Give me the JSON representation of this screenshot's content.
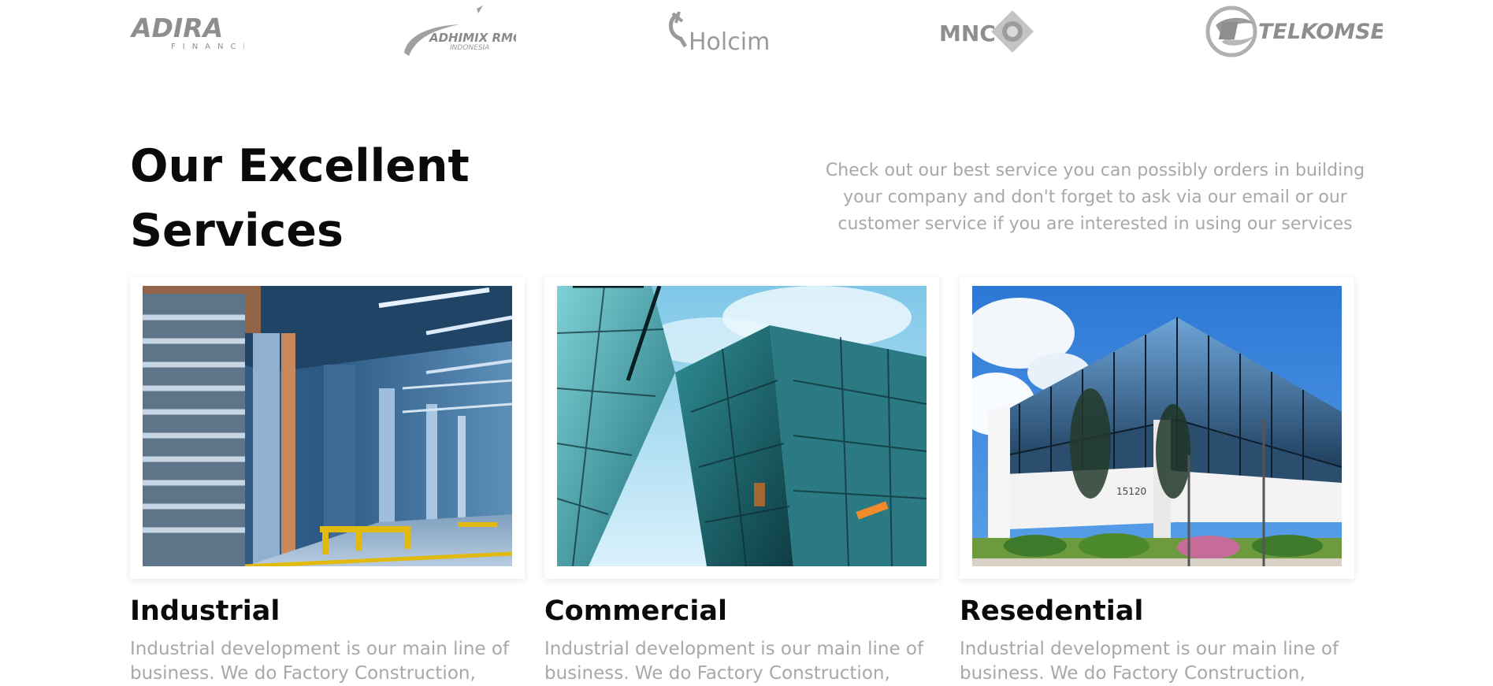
{
  "partners": [
    {
      "name": "ADIRA",
      "sub": "FINANCE"
    },
    {
      "name": "ADHIMIX RMC",
      "sub": "INDONESIA"
    },
    {
      "name": "Holcim"
    },
    {
      "name": "MNC"
    },
    {
      "name": "TELKOMSEL"
    }
  ],
  "services_section": {
    "title_line1": "Our Excellent",
    "title_line2": "Services",
    "intro": "Check out our best service you can possibly orders in building your company and don't forget to ask via our email or our customer service if you are interested in using our services"
  },
  "cards": [
    {
      "title": "Industrial",
      "description": "Industrial development is our main line of business. We do Factory Construction,"
    },
    {
      "title": "Commercial",
      "description": "Industrial development is our main line of business. We do Factory Construction,"
    },
    {
      "title": "Resedential",
      "description": "Industrial development is our main line of business. We do Factory Construction,"
    }
  ],
  "colors": {
    "logo_gray": "#9a9a9a",
    "heading": "#0a0a0a",
    "muted_text": "#a8a8a8"
  }
}
